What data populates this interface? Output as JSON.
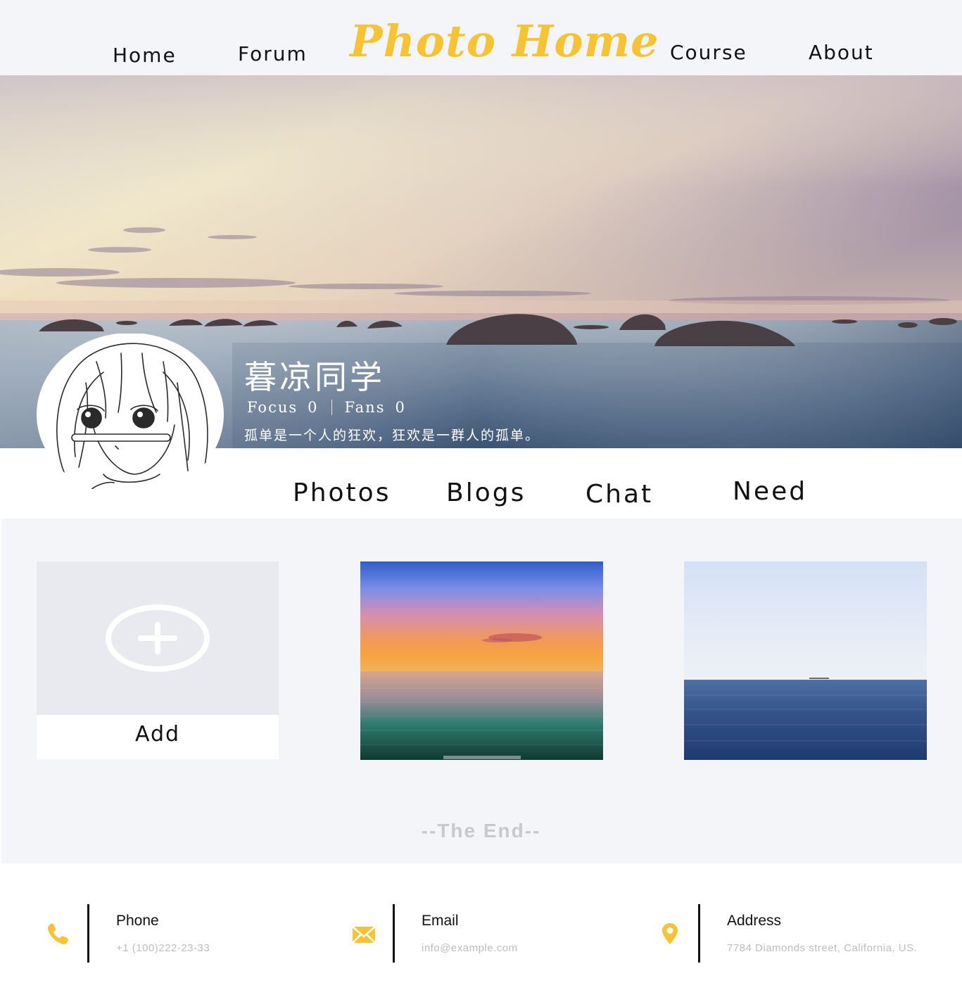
{
  "header": {
    "logo": "Photo Home",
    "nav": {
      "home": "Home",
      "forum": "Forum",
      "course": "Course",
      "about": "About"
    }
  },
  "profile": {
    "name": "暮凉同学",
    "focus_label": "Focus",
    "focus_count": "0",
    "fans_label": "Fans",
    "fans_count": "0",
    "motto": "孤单是一个人的狂欢，狂欢是一群人的孤单。"
  },
  "tabs": {
    "photos": "Photos",
    "blogs": "Blogs",
    "chat": "Chat",
    "need": "Need"
  },
  "gallery": {
    "add_label": "Add",
    "end_text": "--The End--"
  },
  "footer": {
    "phone": {
      "title": "Phone",
      "value": "+1 (100)222-23-33",
      "icon": "phone-icon"
    },
    "email": {
      "title": "Email",
      "value": "info@example.com",
      "icon": "envelope-icon"
    },
    "address": {
      "title": "Address",
      "value": "7784 Diamonds street, California, US.",
      "icon": "map-pin-icon"
    }
  },
  "colors": {
    "brand": "#f6c334",
    "page_bg": "#f4f5f9",
    "muted_text": "#bdbdbd"
  }
}
